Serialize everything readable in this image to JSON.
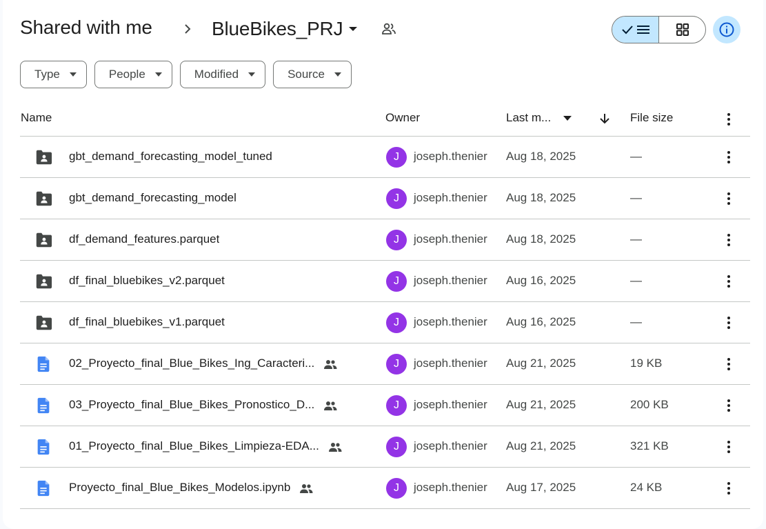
{
  "header": {
    "root_label": "Shared with me",
    "current_folder": "BlueBikes_PRJ"
  },
  "filters": [
    "Type",
    "People",
    "Modified",
    "Source"
  ],
  "columns": {
    "name": "Name",
    "owner": "Owner",
    "modified": "Last m...",
    "size": "File size"
  },
  "colors": {
    "accent": "#c2e7ff",
    "avatar": "#9334e6",
    "doc_icon": "#4285f4",
    "folder_icon": "#444746"
  },
  "rows": [
    {
      "type": "folder",
      "name": "gbt_demand_forecasting_model_tuned",
      "shared": false,
      "owner_initial": "J",
      "owner": "joseph.thenier",
      "modified": "Aug 18, 2025",
      "size": "—"
    },
    {
      "type": "folder",
      "name": "gbt_demand_forecasting_model",
      "shared": false,
      "owner_initial": "J",
      "owner": "joseph.thenier",
      "modified": "Aug 18, 2025",
      "size": "—"
    },
    {
      "type": "folder",
      "name": "df_demand_features.parquet",
      "shared": false,
      "owner_initial": "J",
      "owner": "joseph.thenier",
      "modified": "Aug 18, 2025",
      "size": "—"
    },
    {
      "type": "folder",
      "name": "df_final_bluebikes_v2.parquet",
      "shared": false,
      "owner_initial": "J",
      "owner": "joseph.thenier",
      "modified": "Aug 16, 2025",
      "size": "—"
    },
    {
      "type": "folder",
      "name": "df_final_bluebikes_v1.parquet",
      "shared": false,
      "owner_initial": "J",
      "owner": "joseph.thenier",
      "modified": "Aug 16, 2025",
      "size": "—"
    },
    {
      "type": "doc",
      "name": "02_Proyecto_final_Blue_Bikes_Ing_Caracteri...",
      "shared": true,
      "owner_initial": "J",
      "owner": "joseph.thenier",
      "modified": "Aug 21, 2025",
      "size": "19 KB"
    },
    {
      "type": "doc",
      "name": "03_Proyecto_final_Blue_Bikes_Pronostico_D...",
      "shared": true,
      "owner_initial": "J",
      "owner": "joseph.thenier",
      "modified": "Aug 21, 2025",
      "size": "200 KB"
    },
    {
      "type": "doc",
      "name": "01_Proyecto_final_Blue_Bikes_Limpieza-EDA...",
      "shared": true,
      "owner_initial": "J",
      "owner": "joseph.thenier",
      "modified": "Aug 21, 2025",
      "size": "321 KB"
    },
    {
      "type": "doc",
      "name": "Proyecto_final_Blue_Bikes_Modelos.ipynb",
      "shared": true,
      "owner_initial": "J",
      "owner": "joseph.thenier",
      "modified": "Aug 17, 2025",
      "size": "24 KB"
    }
  ]
}
